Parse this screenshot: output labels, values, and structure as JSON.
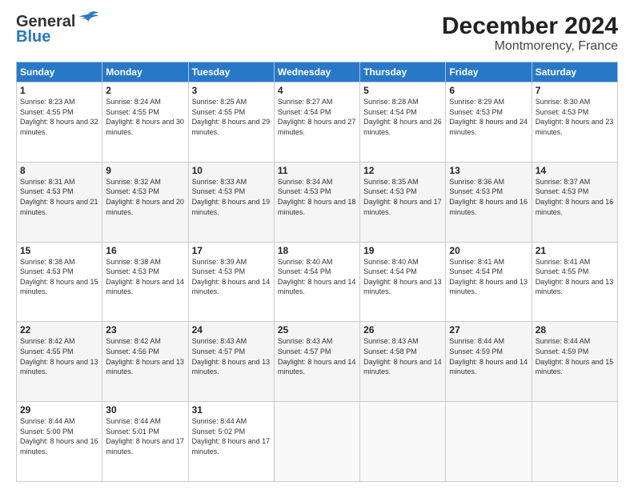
{
  "header": {
    "logo_general": "General",
    "logo_blue": "Blue",
    "month_title": "December 2024",
    "location": "Montmorency, France"
  },
  "days_of_week": [
    "Sunday",
    "Monday",
    "Tuesday",
    "Wednesday",
    "Thursday",
    "Friday",
    "Saturday"
  ],
  "weeks": [
    [
      {
        "day": "1",
        "sunrise": "Sunrise: 8:23 AM",
        "sunset": "Sunset: 4:55 PM",
        "daylight": "Daylight: 8 hours and 32 minutes."
      },
      {
        "day": "2",
        "sunrise": "Sunrise: 8:24 AM",
        "sunset": "Sunset: 4:55 PM",
        "daylight": "Daylight: 8 hours and 30 minutes."
      },
      {
        "day": "3",
        "sunrise": "Sunrise: 8:25 AM",
        "sunset": "Sunset: 4:55 PM",
        "daylight": "Daylight: 8 hours and 29 minutes."
      },
      {
        "day": "4",
        "sunrise": "Sunrise: 8:27 AM",
        "sunset": "Sunset: 4:54 PM",
        "daylight": "Daylight: 8 hours and 27 minutes."
      },
      {
        "day": "5",
        "sunrise": "Sunrise: 8:28 AM",
        "sunset": "Sunset: 4:54 PM",
        "daylight": "Daylight: 8 hours and 26 minutes."
      },
      {
        "day": "6",
        "sunrise": "Sunrise: 8:29 AM",
        "sunset": "Sunset: 4:53 PM",
        "daylight": "Daylight: 8 hours and 24 minutes."
      },
      {
        "day": "7",
        "sunrise": "Sunrise: 8:30 AM",
        "sunset": "Sunset: 4:53 PM",
        "daylight": "Daylight: 8 hours and 23 minutes."
      }
    ],
    [
      {
        "day": "8",
        "sunrise": "Sunrise: 8:31 AM",
        "sunset": "Sunset: 4:53 PM",
        "daylight": "Daylight: 8 hours and 21 minutes."
      },
      {
        "day": "9",
        "sunrise": "Sunrise: 8:32 AM",
        "sunset": "Sunset: 4:53 PM",
        "daylight": "Daylight: 8 hours and 20 minutes."
      },
      {
        "day": "10",
        "sunrise": "Sunrise: 8:33 AM",
        "sunset": "Sunset: 4:53 PM",
        "daylight": "Daylight: 8 hours and 19 minutes."
      },
      {
        "day": "11",
        "sunrise": "Sunrise: 8:34 AM",
        "sunset": "Sunset: 4:53 PM",
        "daylight": "Daylight: 8 hours and 18 minutes."
      },
      {
        "day": "12",
        "sunrise": "Sunrise: 8:35 AM",
        "sunset": "Sunset: 4:53 PM",
        "daylight": "Daylight: 8 hours and 17 minutes."
      },
      {
        "day": "13",
        "sunrise": "Sunrise: 8:36 AM",
        "sunset": "Sunset: 4:53 PM",
        "daylight": "Daylight: 8 hours and 16 minutes."
      },
      {
        "day": "14",
        "sunrise": "Sunrise: 8:37 AM",
        "sunset": "Sunset: 4:53 PM",
        "daylight": "Daylight: 8 hours and 16 minutes."
      }
    ],
    [
      {
        "day": "15",
        "sunrise": "Sunrise: 8:38 AM",
        "sunset": "Sunset: 4:53 PM",
        "daylight": "Daylight: 8 hours and 15 minutes."
      },
      {
        "day": "16",
        "sunrise": "Sunrise: 8:38 AM",
        "sunset": "Sunset: 4:53 PM",
        "daylight": "Daylight: 8 hours and 14 minutes."
      },
      {
        "day": "17",
        "sunrise": "Sunrise: 8:39 AM",
        "sunset": "Sunset: 4:53 PM",
        "daylight": "Daylight: 8 hours and 14 minutes."
      },
      {
        "day": "18",
        "sunrise": "Sunrise: 8:40 AM",
        "sunset": "Sunset: 4:54 PM",
        "daylight": "Daylight: 8 hours and 14 minutes."
      },
      {
        "day": "19",
        "sunrise": "Sunrise: 8:40 AM",
        "sunset": "Sunset: 4:54 PM",
        "daylight": "Daylight: 8 hours and 13 minutes."
      },
      {
        "day": "20",
        "sunrise": "Sunrise: 8:41 AM",
        "sunset": "Sunset: 4:54 PM",
        "daylight": "Daylight: 8 hours and 13 minutes."
      },
      {
        "day": "21",
        "sunrise": "Sunrise: 8:41 AM",
        "sunset": "Sunset: 4:55 PM",
        "daylight": "Daylight: 8 hours and 13 minutes."
      }
    ],
    [
      {
        "day": "22",
        "sunrise": "Sunrise: 8:42 AM",
        "sunset": "Sunset: 4:55 PM",
        "daylight": "Daylight: 8 hours and 13 minutes."
      },
      {
        "day": "23",
        "sunrise": "Sunrise: 8:42 AM",
        "sunset": "Sunset: 4:56 PM",
        "daylight": "Daylight: 8 hours and 13 minutes."
      },
      {
        "day": "24",
        "sunrise": "Sunrise: 8:43 AM",
        "sunset": "Sunset: 4:57 PM",
        "daylight": "Daylight: 8 hours and 13 minutes."
      },
      {
        "day": "25",
        "sunrise": "Sunrise: 8:43 AM",
        "sunset": "Sunset: 4:57 PM",
        "daylight": "Daylight: 8 hours and 14 minutes."
      },
      {
        "day": "26",
        "sunrise": "Sunrise: 8:43 AM",
        "sunset": "Sunset: 4:58 PM",
        "daylight": "Daylight: 8 hours and 14 minutes."
      },
      {
        "day": "27",
        "sunrise": "Sunrise: 8:44 AM",
        "sunset": "Sunset: 4:59 PM",
        "daylight": "Daylight: 8 hours and 14 minutes."
      },
      {
        "day": "28",
        "sunrise": "Sunrise: 8:44 AM",
        "sunset": "Sunset: 4:59 PM",
        "daylight": "Daylight: 8 hours and 15 minutes."
      }
    ],
    [
      {
        "day": "29",
        "sunrise": "Sunrise: 8:44 AM",
        "sunset": "Sunset: 5:00 PM",
        "daylight": "Daylight: 8 hours and 16 minutes."
      },
      {
        "day": "30",
        "sunrise": "Sunrise: 8:44 AM",
        "sunset": "Sunset: 5:01 PM",
        "daylight": "Daylight: 8 hours and 17 minutes."
      },
      {
        "day": "31",
        "sunrise": "Sunrise: 8:44 AM",
        "sunset": "Sunset: 5:02 PM",
        "daylight": "Daylight: 8 hours and 17 minutes."
      },
      null,
      null,
      null,
      null
    ]
  ]
}
